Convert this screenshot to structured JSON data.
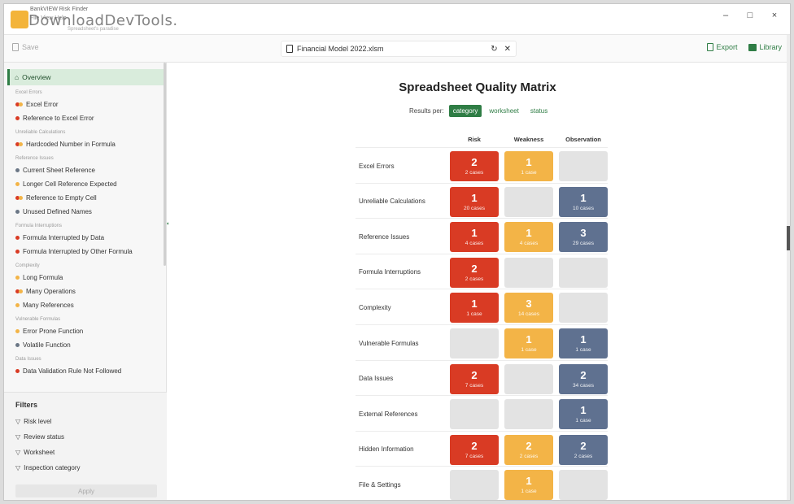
{
  "window": {
    "app_title": "BankVIEW Risk Finder",
    "app_menu": "File  View  Help",
    "app_subtitle": "Spreadsheet's paradise",
    "watermark": "DownloadDevTools.",
    "min_label": "–",
    "max_label": "□",
    "close_label": "×"
  },
  "toolbar": {
    "save_label": "Save",
    "file_name": "Financial Model 2022.xlsm",
    "reload_icon": "↻",
    "close_icon": "✕",
    "export_label": "Export",
    "library_label": "Library"
  },
  "colors": {
    "accent": "#2f7d45",
    "risk": "#d93b24",
    "weakness": "#f3b447",
    "observation": "#5f7190",
    "empty": "#e3e3e3",
    "gray_dot": "#6b7786"
  },
  "sidebar": {
    "overview_label": "Overview",
    "groups": [
      {
        "label": "Excel Errors",
        "items": [
          {
            "label": "Excel Error",
            "dots": [
              "#d93b24",
              "#f3b447"
            ]
          },
          {
            "label": "Reference to Excel Error",
            "dots": [
              "#d93b24"
            ]
          }
        ]
      },
      {
        "label": "Unreliable Calculations",
        "items": [
          {
            "label": "Hardcoded Number in Formula",
            "dots": [
              "#d93b24",
              "#f3b447"
            ]
          }
        ]
      },
      {
        "label": "Reference Issues",
        "items": [
          {
            "label": "Current Sheet Reference",
            "dots": [
              "#6b7786"
            ]
          },
          {
            "label": "Longer Cell Reference Expected",
            "dots": [
              "#f3b447"
            ]
          },
          {
            "label": "Reference to Empty Cell",
            "dots": [
              "#d93b24",
              "#f3b447"
            ]
          },
          {
            "label": "Unused Defined Names",
            "dots": [
              "#6b7786"
            ]
          }
        ]
      },
      {
        "label": "Formula Interruptions",
        "items": [
          {
            "label": "Formula Interrupted by Data",
            "dots": [
              "#d93b24"
            ]
          },
          {
            "label": "Formula Interrupted by Other Formula",
            "dots": [
              "#d93b24"
            ]
          }
        ]
      },
      {
        "label": "Complexity",
        "items": [
          {
            "label": "Long Formula",
            "dots": [
              "#f3b447"
            ]
          },
          {
            "label": "Many Operations",
            "dots": [
              "#d93b24",
              "#f3b447"
            ]
          },
          {
            "label": "Many References",
            "dots": [
              "#f3b447"
            ]
          }
        ]
      },
      {
        "label": "Vulnerable Formulas",
        "items": [
          {
            "label": "Error Prone Function",
            "dots": [
              "#f3b447"
            ]
          },
          {
            "label": "Volatile Function",
            "dots": [
              "#6b7786"
            ]
          }
        ]
      },
      {
        "label": "Data Issues",
        "items": [
          {
            "label": "Data Validation Rule Not Followed",
            "dots": [
              "#d93b24"
            ]
          }
        ]
      }
    ]
  },
  "filters": {
    "title": "Filters",
    "items": [
      "Risk level",
      "Review status",
      "Worksheet",
      "Inspection category"
    ],
    "apply_label": "Apply"
  },
  "main": {
    "title": "Spreadsheet Quality Matrix",
    "results_per_label": "Results per:",
    "tabs": [
      {
        "label": "category",
        "active": true
      },
      {
        "label": "worksheet",
        "active": false
      },
      {
        "label": "status",
        "active": false
      }
    ],
    "columns": [
      "Risk",
      "Weakness",
      "Observation"
    ],
    "rows": [
      {
        "label": "Excel Errors",
        "cells": [
          {
            "n": "2",
            "c": "2 cases"
          },
          {
            "n": "1",
            "c": "1 case"
          },
          null
        ]
      },
      {
        "label": "Unreliable Calculations",
        "cells": [
          {
            "n": "1",
            "c": "20 cases"
          },
          null,
          {
            "n": "1",
            "c": "10 cases"
          }
        ]
      },
      {
        "label": "Reference Issues",
        "cells": [
          {
            "n": "1",
            "c": "4 cases"
          },
          {
            "n": "1",
            "c": "4 cases"
          },
          {
            "n": "3",
            "c": "29 cases"
          }
        ]
      },
      {
        "label": "Formula Interruptions",
        "cells": [
          {
            "n": "2",
            "c": "2 cases"
          },
          null,
          null
        ]
      },
      {
        "label": "Complexity",
        "cells": [
          {
            "n": "1",
            "c": "1 case"
          },
          {
            "n": "3",
            "c": "14 cases"
          },
          null
        ]
      },
      {
        "label": "Vulnerable Formulas",
        "cells": [
          null,
          {
            "n": "1",
            "c": "1 case"
          },
          {
            "n": "1",
            "c": "1 case"
          }
        ]
      },
      {
        "label": "Data Issues",
        "cells": [
          {
            "n": "2",
            "c": "7 cases"
          },
          null,
          {
            "n": "2",
            "c": "34 cases"
          }
        ]
      },
      {
        "label": "External References",
        "cells": [
          null,
          null,
          {
            "n": "1",
            "c": "1 case"
          }
        ]
      },
      {
        "label": "Hidden Information",
        "cells": [
          {
            "n": "2",
            "c": "7 cases"
          },
          {
            "n": "2",
            "c": "2 cases"
          },
          {
            "n": "2",
            "c": "2 cases"
          }
        ]
      },
      {
        "label": "File & Settings",
        "cells": [
          null,
          {
            "n": "1",
            "c": "1 case"
          },
          null
        ]
      }
    ]
  }
}
